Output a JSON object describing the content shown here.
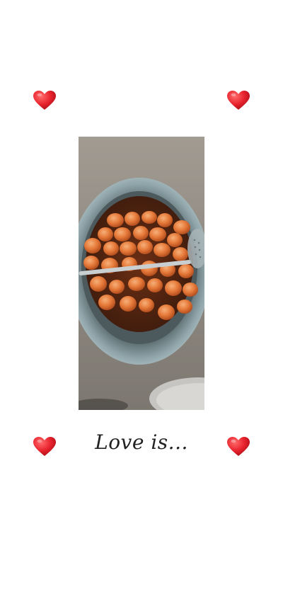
{
  "caption": "Love is...",
  "colors": {
    "background": "#ffffff",
    "heart": "#e8232e",
    "caption": "#222222"
  },
  "icons": {
    "hearts": [
      "heart-icon",
      "heart-icon",
      "heart-icon",
      "heart-icon"
    ]
  },
  "photo": {
    "subject": "pan-of-sweets-photo"
  }
}
